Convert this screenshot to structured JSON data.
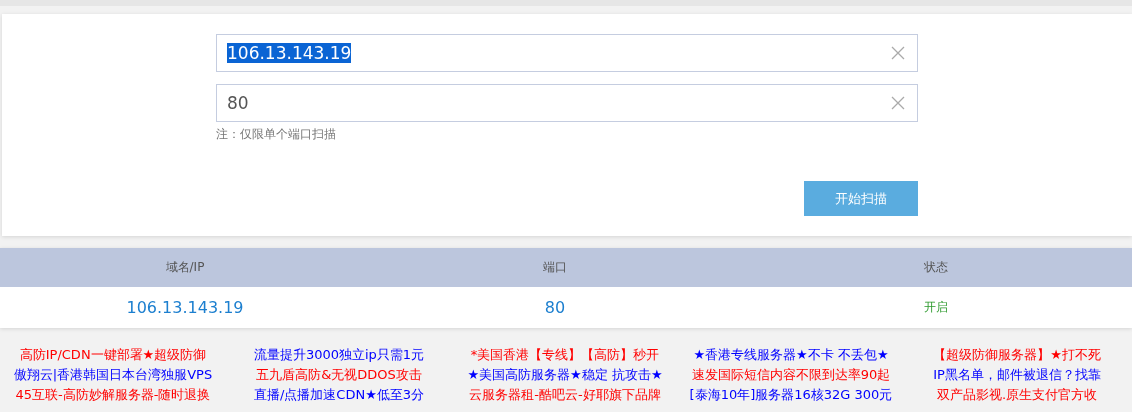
{
  "form": {
    "fields": [
      {
        "value": "106.13.143.19",
        "selected": true
      },
      {
        "value": "80",
        "selected": false
      }
    ],
    "note": "注：仅限单个端口扫描",
    "button": "开始扫描"
  },
  "table": {
    "columns": [
      "域名/IP",
      "端口",
      "状态"
    ],
    "rows": [
      {
        "cells": [
          "106.13.143.19",
          "80",
          "开启"
        ],
        "open": true
      }
    ]
  },
  "ads": [
    [
      {
        "text": "高防IP/CDN一键部署★超级防御",
        "color": "#ff0000"
      },
      {
        "text": "傲翔云|香港韩国日本台湾独服VPS",
        "color": "#0000ff"
      },
      {
        "text": "45互联-高防妙解服务器-随时退换",
        "color": "#ff0000"
      }
    ],
    [
      {
        "text": "流量提升3000独立ip只需1元",
        "color": "#0000ff"
      },
      {
        "text": "五九盾高防&无视DDOS攻击",
        "color": "#ff0000"
      },
      {
        "text": "直播/点播加速CDN★低至3分",
        "color": "#0000ff"
      }
    ],
    [
      {
        "text": "*美国香港【专线】【高防】秒开",
        "color": "#ff0000"
      },
      {
        "text": "★美国高防服务器★稳定 抗攻击★",
        "color": "#0000ff"
      },
      {
        "text": "云服务器租-酷吧云-好耶旗下品牌",
        "color": "#ff0000"
      }
    ],
    [
      {
        "text": "★香港专线服务器★不卡 不丢包★",
        "color": "#0000ff"
      },
      {
        "text": "速发国际短信内容不限到达率90起",
        "color": "#ff0000"
      },
      {
        "text": "[泰海10年]服务器16核32G 300元",
        "color": "#0000ff"
      }
    ],
    [
      {
        "text": "【超级防御服务器】★打不死",
        "color": "#ff0000"
      },
      {
        "text": "IP黑名单，邮件被退信？找靠",
        "color": "#0000ff"
      },
      {
        "text": "双产品影视.原生支付官方收",
        "color": "#ff0000"
      }
    ]
  ]
}
